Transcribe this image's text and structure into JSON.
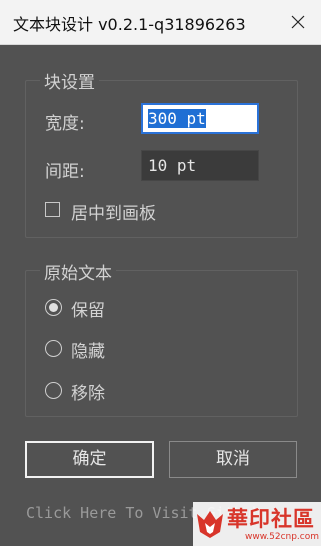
{
  "window": {
    "title": "文本块设计 v0.2.1-q31896263"
  },
  "block_settings": {
    "title": "块设置",
    "width_label": "宽度:",
    "width_value": "300 pt",
    "spacing_label": "间距:",
    "spacing_value": "10 pt",
    "center_checkbox_label": "居中到画板",
    "center_checked": false
  },
  "source_text": {
    "title": "原始文本",
    "options": [
      {
        "label": "保留",
        "checked": true
      },
      {
        "label": "隐藏",
        "checked": false
      },
      {
        "label": "移除",
        "checked": false
      }
    ]
  },
  "buttons": {
    "ok": "确定",
    "cancel": "取消"
  },
  "footer": {
    "link_text": "Click Here To Visit Github"
  },
  "watermark": {
    "name": "華印社區",
    "url": "www.52cnp.com"
  },
  "colors": {
    "background": "#525252",
    "titlebar": "#f3f3f3",
    "selection": "#1f6fd4",
    "watermark_red": "#d8352a"
  },
  "icons": {
    "close": "close-icon",
    "watermark_logo": "bat-logo-icon"
  }
}
